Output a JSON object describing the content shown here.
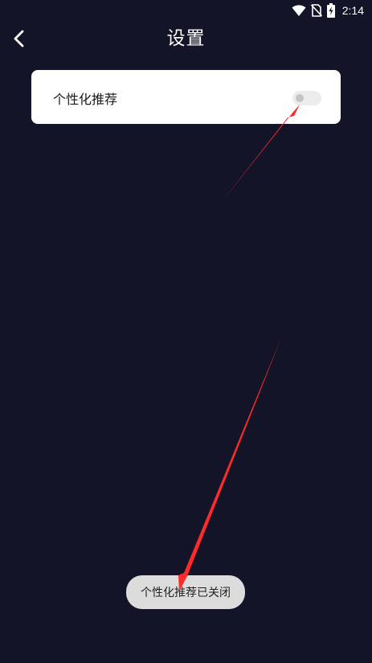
{
  "status_bar": {
    "time": "2:14",
    "icons": [
      "wifi-icon",
      "no-sim-icon",
      "battery-charging-icon"
    ]
  },
  "header": {
    "title": "设置",
    "back_icon": "chevron-left-icon"
  },
  "settings": {
    "items": [
      {
        "label": "个性化推荐",
        "toggle_on": false
      }
    ]
  },
  "toast": {
    "message": "个性化推荐已关闭"
  },
  "colors": {
    "background": "#141428",
    "card": "#ffffff",
    "toast_bg": "#dcdcdc",
    "annotation_arrow": "#ff2a2a"
  }
}
